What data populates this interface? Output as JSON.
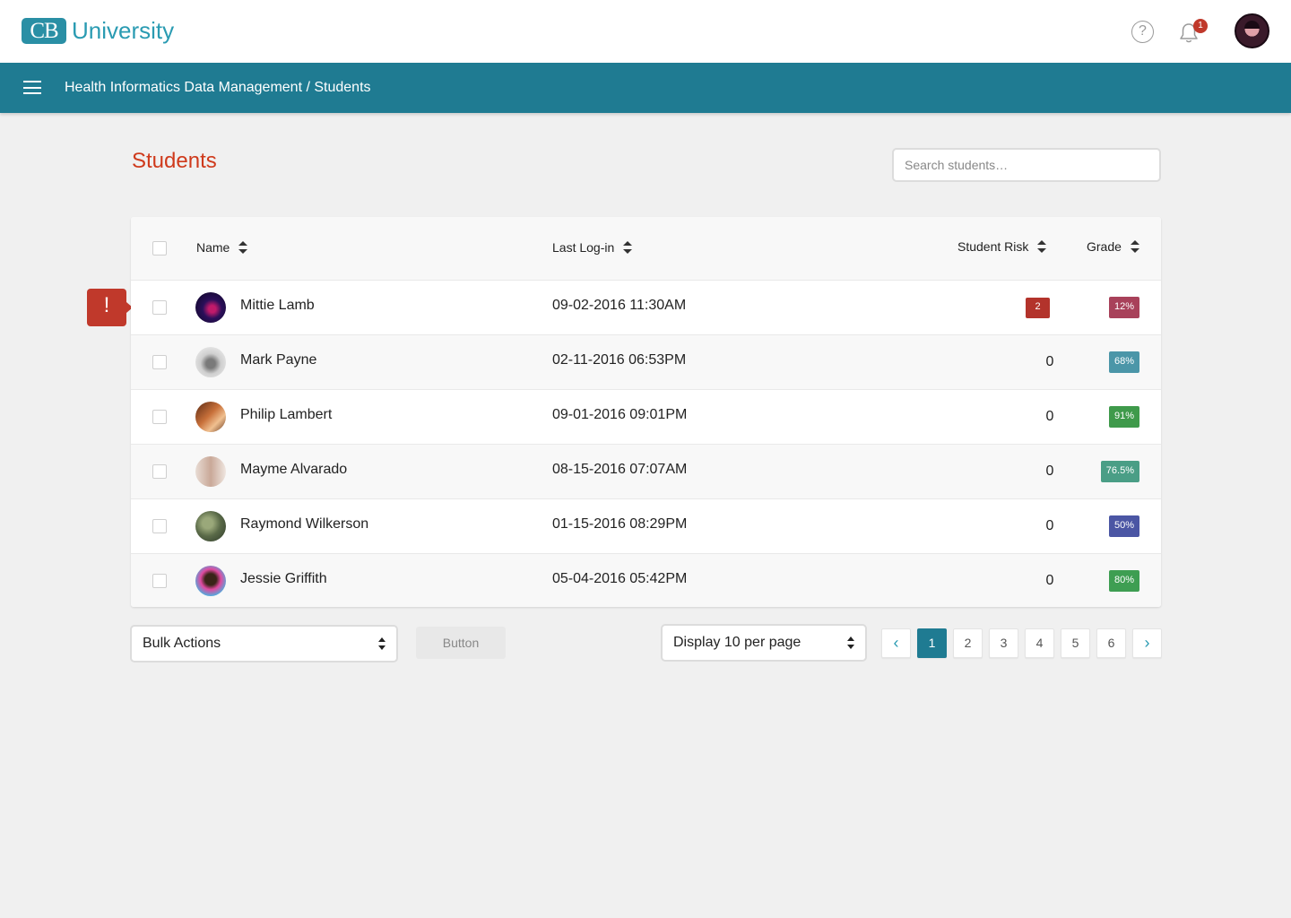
{
  "app": {
    "logo_initials": "CB",
    "logo_text": "University",
    "help_glyph": "?",
    "notifications_count": "1"
  },
  "nav": {
    "breadcrumb_course": "Health Informatics Data Management",
    "breadcrumb_sep": " / ",
    "breadcrumb_page": "Students"
  },
  "page": {
    "title": "Students",
    "search_placeholder": "Search students…"
  },
  "table": {
    "headers": {
      "name": "Name",
      "last_login": "Last Log-in",
      "risk": "Student Risk",
      "grade": "Grade"
    },
    "rows": [
      {
        "name": "Mittie Lamb",
        "last_login": "09-02-2016  11:30AM",
        "risk": "2",
        "grade": "12%",
        "grade_color": "#a8415a",
        "flagged": true
      },
      {
        "name": "Mark Payne",
        "last_login": "02-11-2016  06:53PM",
        "risk": "0",
        "grade": "68%",
        "grade_color": "#4b96a8"
      },
      {
        "name": "Philip Lambert",
        "last_login": "09-01-2016  09:01PM",
        "risk": "0",
        "grade": "91%",
        "grade_color": "#3f9a4b"
      },
      {
        "name": "Mayme Alvarado",
        "last_login": "08-15-2016  07:07AM",
        "risk": "0",
        "grade": "76.5%",
        "grade_color": "#4a9e86"
      },
      {
        "name": "Raymond Wilkerson",
        "last_login": "01-15-2016  08:29PM",
        "risk": "0",
        "grade": "50%",
        "grade_color": "#4b56a4"
      },
      {
        "name": "Jessie Griffith",
        "last_login": "05-04-2016  05:42PM",
        "risk": "0",
        "grade": "80%",
        "grade_color": "#3e9e52"
      }
    ]
  },
  "alert_glyph": "!",
  "footer": {
    "bulk_actions": "Bulk Actions",
    "button_label": "Button",
    "per_page": "Display 10 per page",
    "pages": [
      "1",
      "2",
      "3",
      "4",
      "5",
      "6"
    ],
    "active_page": "1",
    "prev_glyph": "‹",
    "next_glyph": "›"
  },
  "colors": {
    "brand": "#1f7b92",
    "title": "#cf3a1c",
    "risk_badge": "#b3332b"
  }
}
